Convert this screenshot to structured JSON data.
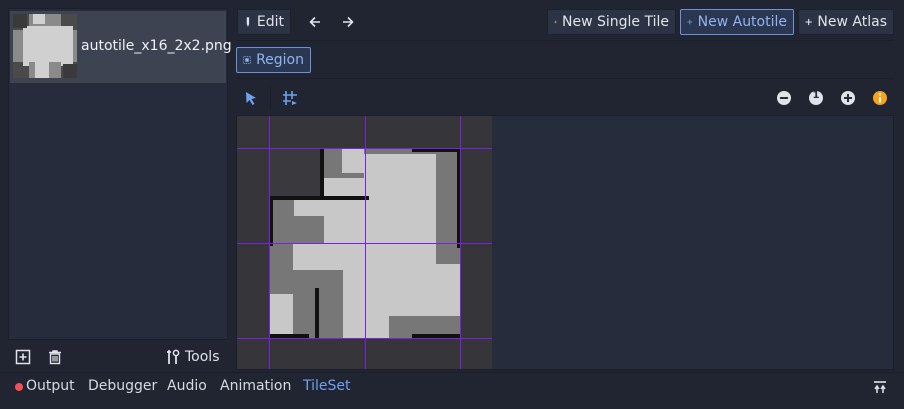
{
  "texture_list": {
    "items": [
      {
        "label": "autotile_x16_2x2.png"
      }
    ]
  },
  "toolbar": {
    "edit_label": "Edit",
    "new_single_tile_label": "New Single Tile",
    "new_autotile_label": "New Autotile",
    "new_atlas_label": "New Atlas"
  },
  "mode": {
    "region_label": "Region"
  },
  "zoom": {
    "reset_label": "1"
  },
  "left_bottom": {
    "tools_label": "Tools"
  },
  "bottom_panel": {
    "tabs": [
      {
        "label": "Output"
      },
      {
        "label": "Debugger"
      },
      {
        "label": "Audio"
      },
      {
        "label": "Animation"
      },
      {
        "label": "TileSet"
      }
    ],
    "active_tab": "TileSet"
  },
  "colors": {
    "accent": "#6b92d6",
    "active_tab": "#6fa1ef",
    "grid_line": "#7a22e0",
    "error_dot": "#f0505a",
    "warning": "#f6a31e"
  }
}
